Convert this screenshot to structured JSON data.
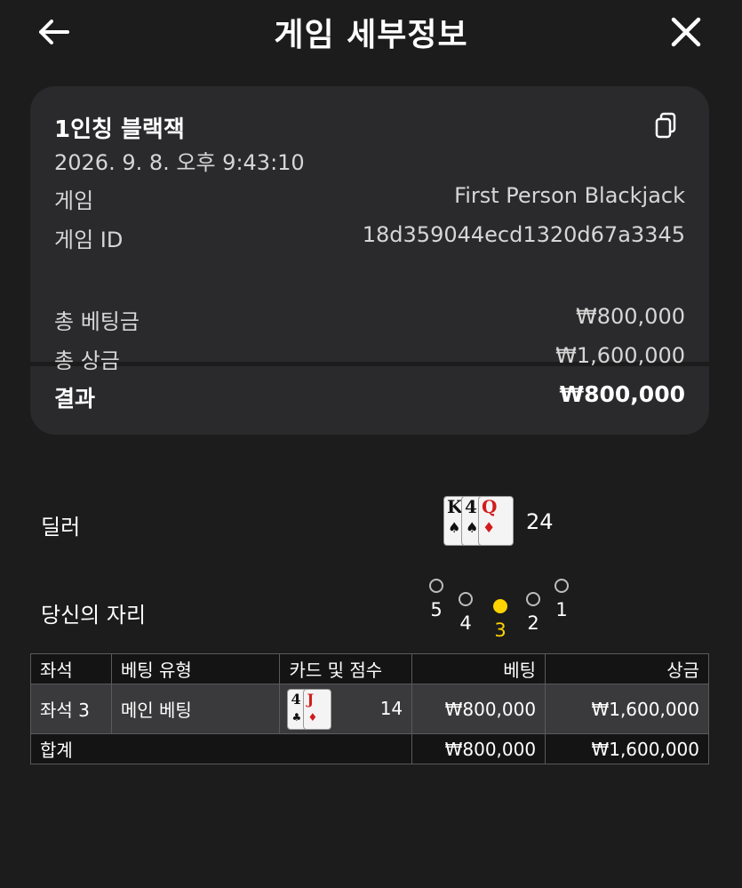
{
  "header": {
    "title": "게임 세부정보",
    "back_icon": "arrow-left-icon",
    "close_icon": "close-icon"
  },
  "summary": {
    "game_name": "1인칭 블랙잭",
    "datetime": "2026. 9. 8. 오후 9:43:10",
    "copy_icon": "copy-icon",
    "game_label": "게임",
    "game_value": "First Person Blackjack",
    "game_id_label": "게임 ID",
    "game_id_value": "18d359044ecd1320d67a3345",
    "total_bet_label": "총 베팅금",
    "total_bet_value": "₩800,000",
    "total_win_label": "총 상금",
    "total_win_value": "₩1,600,000",
    "result_label": "결과",
    "result_value": "₩800,000"
  },
  "dealer": {
    "label": "딜러",
    "cards": [
      {
        "rank": "K",
        "suit": "♠",
        "color": "#111111"
      },
      {
        "rank": "4",
        "suit": "♠",
        "color": "#111111"
      },
      {
        "rank": "Q",
        "suit": "♦",
        "color": "#d21c1c"
      }
    ],
    "score": "24"
  },
  "seats": {
    "label": "당신의 자리",
    "items": [
      {
        "number": "5",
        "active": false
      },
      {
        "number": "4",
        "active": false
      },
      {
        "number": "3",
        "active": true
      },
      {
        "number": "2",
        "active": false
      },
      {
        "number": "1",
        "active": false
      }
    ],
    "active_color": "#ffd400"
  },
  "bets_table": {
    "headers": [
      "좌석",
      "베팅 유형",
      "카드 및 점수",
      "베팅",
      "상금"
    ],
    "rows": [
      {
        "seat": "좌석 3",
        "bet_type": "메인 베팅",
        "cards": [
          {
            "rank": "4",
            "suit": "♣",
            "color": "#111111"
          },
          {
            "rank": "J",
            "suit": "♦",
            "color": "#d21c1c"
          }
        ],
        "score": "14",
        "bet": "₩800,000",
        "win": "₩1,600,000"
      }
    ],
    "total": {
      "label": "합계",
      "bet": "₩800,000",
      "win": "₩1,600,000"
    }
  }
}
